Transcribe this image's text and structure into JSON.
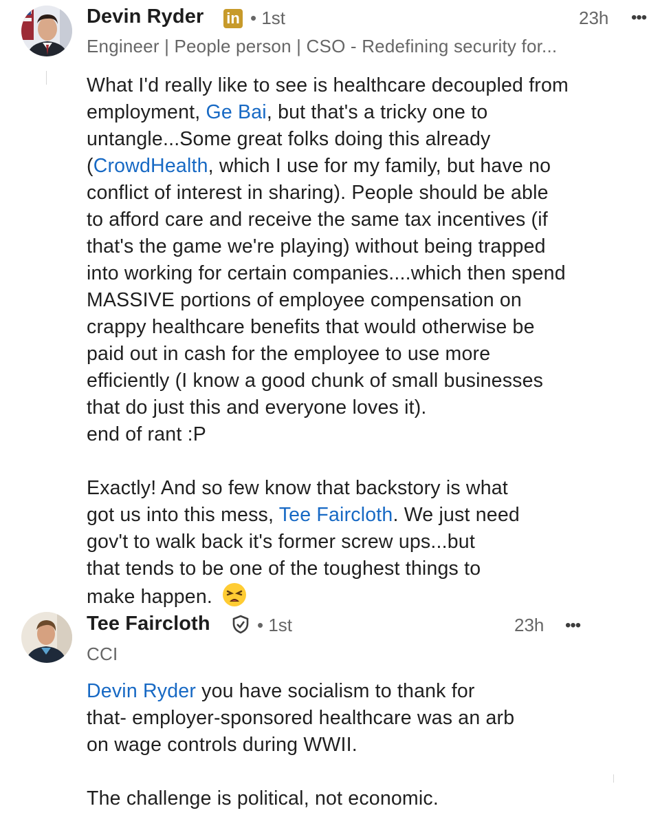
{
  "comments": [
    {
      "author": "Devin Ryder",
      "degree": "• 1st",
      "badge": "in",
      "headline": "Engineer | People person | CSO - Redefining security for...",
      "time": "23h",
      "more": "•••",
      "body_lines": [
        [
          "What I'd really like to see is healthcare decoupled from"
        ],
        [
          "employment, ",
          {
            "mention": "Ge Bai"
          },
          ", but that's a tricky one to"
        ],
        [
          "untangle...Some great folks doing this already"
        ],
        [
          "(",
          {
            "mention": "CrowdHealth"
          },
          ", which I use for my family, but have no"
        ],
        [
          "conflict of interest in sharing). People should be able"
        ],
        [
          "to afford care and receive the same tax incentives (if"
        ],
        [
          "that's the game we're playing) without being trapped"
        ],
        [
          "into working for certain companies....which then spend"
        ],
        [
          "MASSIVE portions of employee compensation on"
        ],
        [
          "crappy healthcare benefits that would otherwise be"
        ],
        [
          "paid out in cash for the employee to use more"
        ],
        [
          "efficiently (I know a good chunk of small businesses"
        ],
        [
          "that do just this and everyone loves it)."
        ],
        [
          "end of rant :P"
        ],
        [],
        [
          "Exactly! And so few know that backstory is what"
        ],
        [
          "got us into this mess, ",
          {
            "mention": "Tee Faircloth"
          },
          ". We just need"
        ],
        [
          "gov't to walk back it's former screw ups...but"
        ],
        [
          "that tends to be one of the toughest things to"
        ],
        [
          "make happen. ",
          {
            "emoji": "tired-face-emoji"
          }
        ]
      ]
    },
    {
      "author": "Tee Faircloth",
      "degree": "• 1st",
      "badge": "verified-shield-icon",
      "headline": "CCI",
      "time": "23h",
      "more": "•••",
      "body_lines": [
        [
          {
            "mention": "Devin Ryder"
          },
          " you have socialism to thank for"
        ],
        [
          "that- employer-sponsored healthcare was an arb"
        ],
        [
          "on wage controls during WWII."
        ],
        [],
        [
          "The challenge is political, not economic."
        ]
      ]
    }
  ]
}
